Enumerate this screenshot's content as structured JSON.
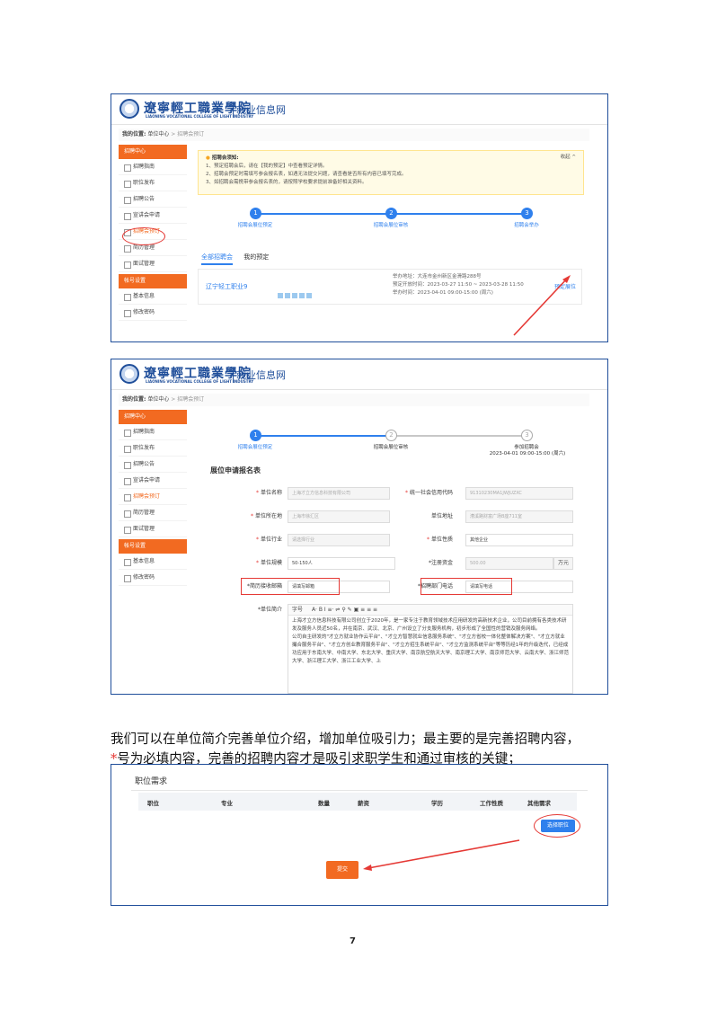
{
  "site": {
    "logo_cn": "遼寧輕工職業學院",
    "logo_en": "LIAONING VOCATIONAL COLLEGE OF LIGHT INDUSTRY",
    "site_name": "就业信息网"
  },
  "breadcrumb": {
    "prefix": "我的位置:",
    "home": "单位中心",
    "sep": ">",
    "current": "招聘会预订"
  },
  "sidebar": {
    "section1": "招聘中心",
    "items": [
      "招聘指南",
      "职位发布",
      "招聘公告",
      "宣讲会申请",
      "招聘会预订",
      "简历管理",
      "面试管理"
    ],
    "section2": "帐号设置",
    "items2": [
      "基本信息",
      "修改密码"
    ]
  },
  "notice": {
    "title": "招聘会须知:",
    "fold": "收起 ^",
    "lines": [
      "1、预定招聘会后，请在【我的预定】中查看预定详情。",
      "2、招聘会预定时需填写参会报名表，如遇无法提交问题，请查看是否所有内容已填写完成。",
      "3、如招聘会需携带参会报名表的，请按照学校要求提前准备好相关资料。"
    ]
  },
  "steps1": [
    "招聘会展位预定",
    "招聘会展位审核",
    "招聘会举办"
  ],
  "tabs": [
    "全部招聘会",
    "我的预定"
  ],
  "fair": {
    "name": "辽宁轻工职业9",
    "address": "举办地址：大连市金州新区金滑路288号",
    "booking": "预定开放时间：2023-03-27 11:50 ~ 2023-03-28 11:50",
    "hold": "举办时间：2023-04-01 09:00-15:00 (周六)",
    "action": "预定展位"
  },
  "steps2": [
    "招聘会展位预定",
    "招聘会展位审核",
    "参加招聘会"
  ],
  "steps2_date": "2023-04-01 09:00-15:00 (周六)",
  "form": {
    "title": "展位申请报名表",
    "fields": [
      {
        "label": "单位名称",
        "value": "上海才立方信息科技有限公司",
        "req": true
      },
      {
        "label": "统一社会信用代码",
        "value": "91310230MA1JWJUZXC",
        "req": true
      },
      {
        "label": "单位所在地",
        "value": "上海市徐汇区",
        "req": true
      },
      {
        "label": "单位地址",
        "value": "漕溪路财富广场B座711室",
        "req": false
      },
      {
        "label": "单位行业",
        "value": "请选择行业",
        "req": true
      },
      {
        "label": "单位性质",
        "value": "其他企业",
        "req": true
      },
      {
        "label": "单位规模",
        "value": "50-150人",
        "req": true
      },
      {
        "label": "*注册资金",
        "value": "500.00",
        "req": false
      },
      {
        "label": "*简历接收邮箱",
        "value": "请填写邮箱",
        "req": false
      },
      {
        "label": "*招聘部门电话",
        "value": "请填写电话",
        "req": false
      },
      {
        "label": "*单位简介",
        "value": "",
        "req": false
      }
    ],
    "unit": "万元",
    "editor_font": "字号",
    "editor_tools": "A· B I ≡· ⇌ ⚲ ✎ ▣ ≡ ≡ ≡",
    "intro": [
      "上海才立方信息科技有限公司创立于2020年，是一家专注于教育领域技术应用研发的高新技术企业，公司目前拥有各类技术研发及服务人员近50名，并在南京、武汉、北京、广州设立了分支服务机构，初步形成了全国性的营销及服务网络。",
      "公司自主研发的\"才立方就业协作云平台\"、\"才立方智慧就业信息服务系统\"、\"才立方省校一体化整体解决方案\"、\"才立方就业撮合服务平台\"、\"才立方创业教育服务平台\"、\"才立方招生系统平台\"、\"才立方监测系统平台\"等等历经1年的升级迭代，已经成功应用于东南大学、中南大学、东北大学、重庆大学、南京航空航天大学、南京理工大学、南京师范大学、云南大学、浙江师范大学、浙江理工大学、浙江工业大学、上"
    ]
  },
  "paragraph": {
    "line1": "我们可以在单位简介完善单位介绍，增加单位吸引力；最主要的是完善招聘内容，",
    "star": "*",
    "line2": "号为必填内容，完善的招聘内容才是吸引求职学生和通过审核的关键；"
  },
  "jobs": {
    "title": "职位需求",
    "columns": [
      "职位",
      "专业",
      "数量",
      "薪资",
      "学历",
      "工作性质",
      "其他需求"
    ],
    "select_button": "选择职位",
    "submit_button": "提交"
  },
  "page_number": "7",
  "colors": {
    "brand": "#1f4e9a",
    "orange": "#f26a21",
    "accent": "#2f80ed",
    "annotation": "#e53935"
  }
}
